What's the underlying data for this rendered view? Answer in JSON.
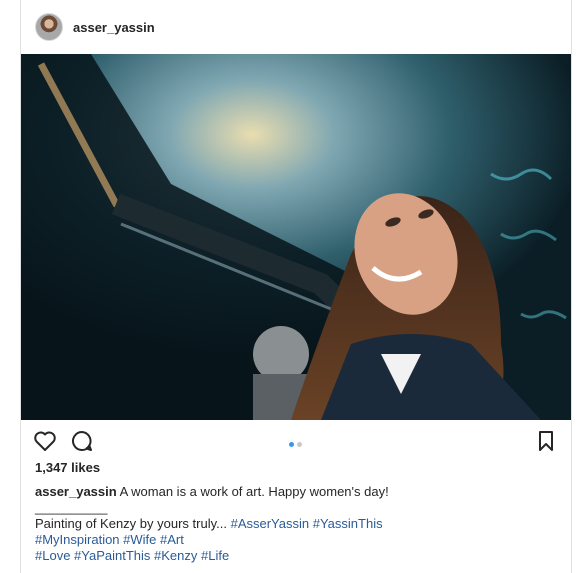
{
  "post": {
    "username": "asser_yassin",
    "likes": "1,347 likes",
    "caption": {
      "username": "asser_yassin",
      "text": "A woman is a work of art. Happy women's day!",
      "divider": "__________",
      "line3_text": "Painting of Kenzy by yours truly...",
      "line3_tags": [
        "#AsserYassin",
        "#YassinThis"
      ],
      "line4_tags": [
        "#MyInspiration",
        "#Wife",
        "#Art"
      ],
      "line5_tags": [
        "#Love",
        "#YaPaintThis",
        "#Kenzy",
        "#Life"
      ]
    },
    "carousel": {
      "count": 2,
      "active": 1
    }
  },
  "colors": {
    "hashtag": "#2a5b99",
    "dot_active": "#3897f0",
    "dot_inactive": "#c8c8c8"
  },
  "icons": [
    "heart-icon",
    "comment-icon",
    "bookmark-icon"
  ]
}
